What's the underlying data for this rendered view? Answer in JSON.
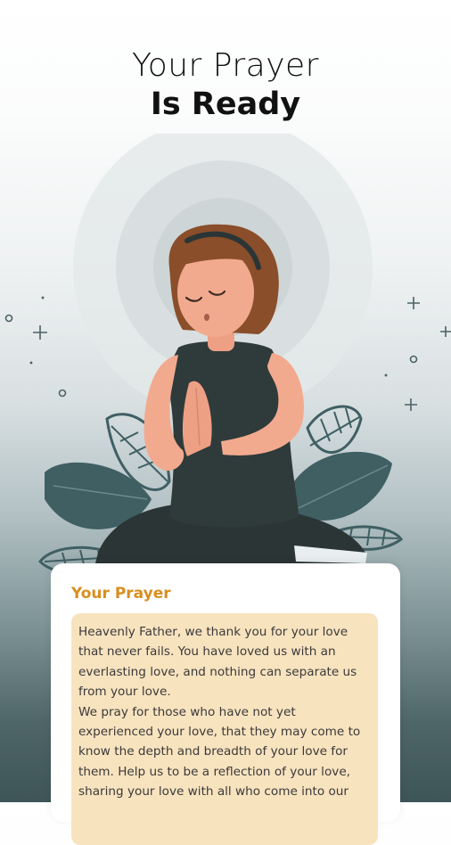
{
  "header": {
    "title_line1": "Your Prayer",
    "title_line2": "Is Ready"
  },
  "illustration": {
    "subject": "praying-woman",
    "colors": {
      "skin": "#f2aa8e",
      "hair": "#8a4e2a",
      "shirt": "#2f3a3b",
      "leaf": "#3f5f63",
      "halo": "#d6dcde"
    }
  },
  "prayer_card": {
    "title": "Your Prayer",
    "text": "Heavenly Father, we thank you for your love that never fails. You have loved us with an everlasting love, and nothing can separate us from your love.\nWe pray for those who have not yet experienced your love, that they may come to know the depth and breadth of your love for them. Help us to be a reflection of your love, sharing your love with all who come into our"
  },
  "colors": {
    "accent": "#d98e1f",
    "text_bg": "#f8e3bf"
  }
}
